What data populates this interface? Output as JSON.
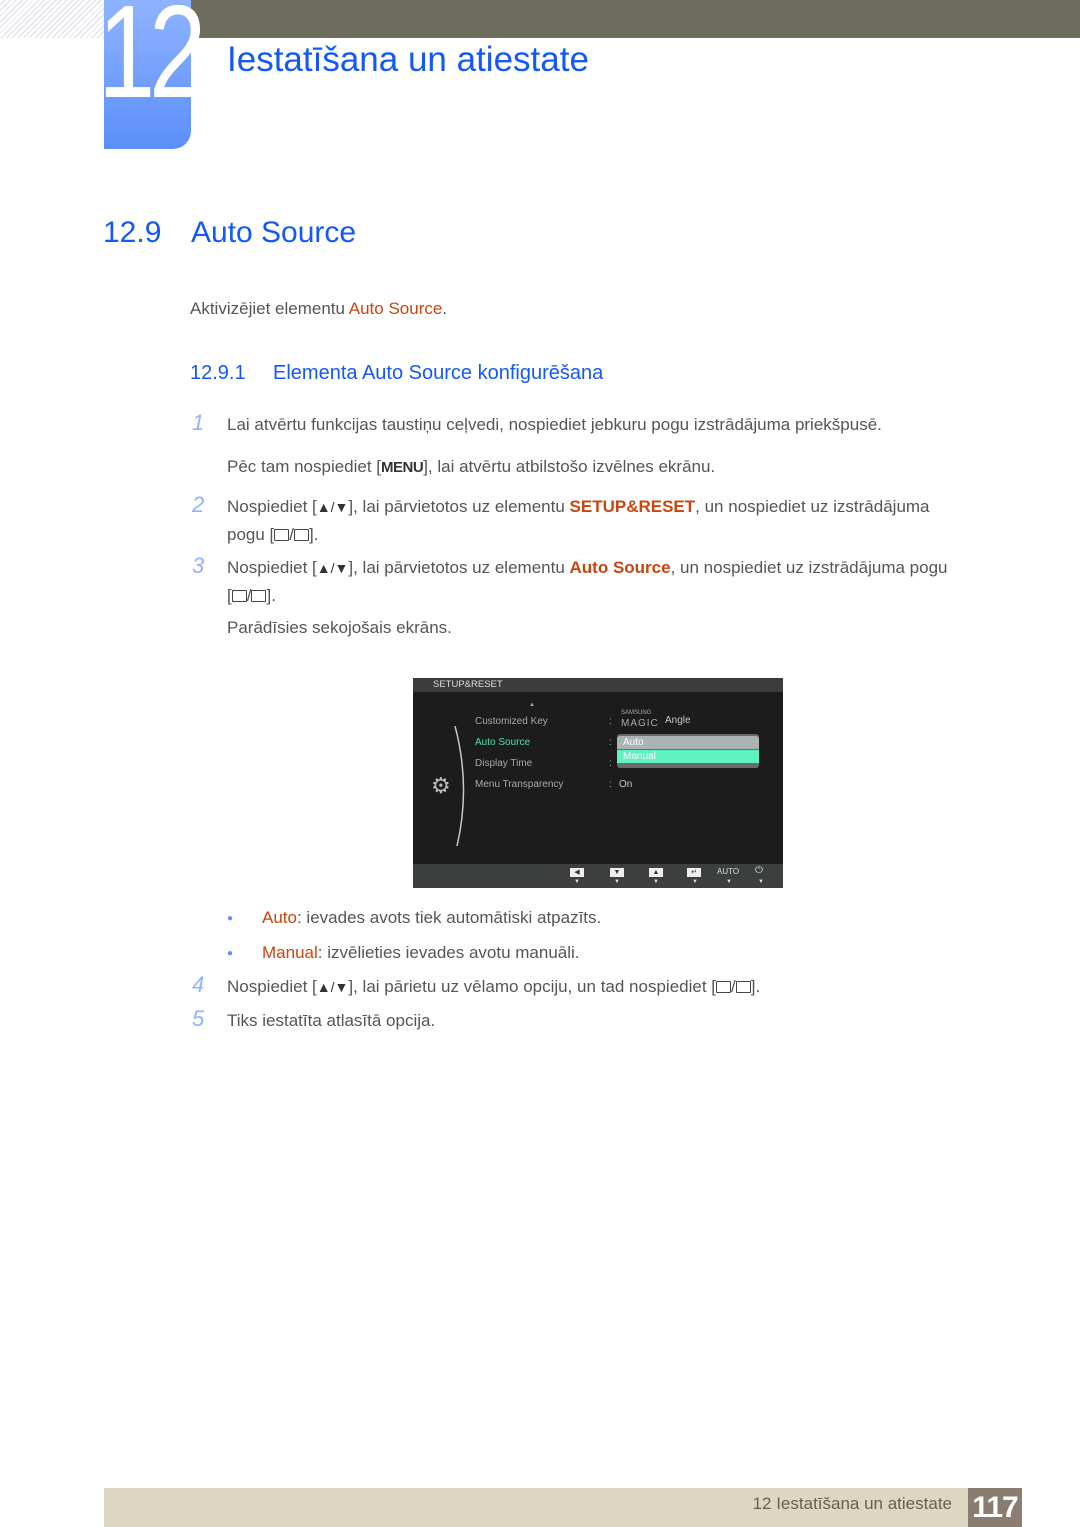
{
  "chapter": {
    "number": "12",
    "title": "Iestatīšana un atiestate"
  },
  "section": {
    "number": "12.9",
    "title": "Auto Source"
  },
  "intro": {
    "text": "Aktivizējiet elementu ",
    "highlight": "Auto Source",
    "end": "."
  },
  "subsection": {
    "number": "12.9.1",
    "title": "Elementa Auto Source konfigurēšana"
  },
  "steps": [
    {
      "num": "1",
      "line1": "Lai atvērtu funkcijas taustiņu ceļvedi, nospiediet jebkuru pogu izstrādājuma priekšpusē.",
      "line2_a": "Pēc tam nospiediet [",
      "menu_key": "MENU",
      "line2_b": "], lai atvērtu atbilstošo izvēlnes ekrānu."
    },
    {
      "num": "2",
      "a": "Nospiediet [",
      "arrows": "▲/▼",
      "b": "], lai pārvietotos uz elementu ",
      "highlight": "SETUP&RESET",
      "c": ", un nospiediet uz izstrādājuma",
      "line2_a": "pogu [",
      "line2_b": "]."
    },
    {
      "num": "3",
      "a": "Nospiediet [",
      "arrows": "▲/▼",
      "b": "], lai pārvietotos uz elementu ",
      "highlight": "Auto Source",
      "c": ", un nospiediet uz izstrādājuma pogu",
      "line2_a": "[",
      "line2_b": "].",
      "note": "Parādīsies sekojošais ekrāns."
    },
    {
      "num": "4",
      "a": "Nospiediet [",
      "arrows": "▲/▼",
      "b": "], lai pārietu uz vēlamo opciju, un tad nospiediet [",
      "c": "]."
    },
    {
      "num": "5",
      "text": "Tiks iestatīta atlasītā opcija."
    }
  ],
  "bullets": [
    {
      "term": "Auto",
      "desc": ": ievades avots tiek automātiski atpazīts."
    },
    {
      "term": "Manual",
      "desc": ": izvēlieties ievades avotu manuāli."
    }
  ],
  "osd": {
    "header": "SETUP&RESET",
    "items": [
      {
        "label": "Customized Key",
        "value_brand": "SAMSUNG",
        "value_magic": "MAGIC",
        "value": "Angle"
      },
      {
        "label": "Auto Source",
        "selected": true
      },
      {
        "label": "Display Time",
        "value": ""
      },
      {
        "label": "Menu Transparency",
        "value": "On"
      }
    ],
    "dropdown": [
      "Auto",
      "Manual"
    ],
    "footer": {
      "auto_label": "AUTO"
    }
  },
  "footer": {
    "text": "12 Iestatīšana un atiestate",
    "page": "117"
  },
  "colors": {
    "accent_blue": "#1458f5",
    "highlight_orange": "#c9440e",
    "osd_selected": "#4fe0a8"
  }
}
